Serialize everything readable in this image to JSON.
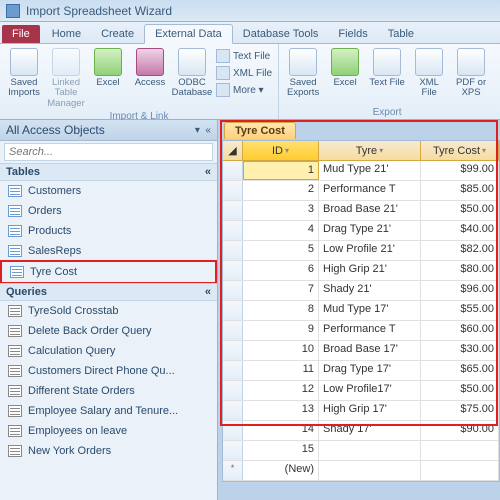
{
  "titlebar": {
    "title": "Import Spreadsheet Wizard"
  },
  "tabs": {
    "file": "File",
    "items": [
      "Home",
      "Create",
      "External Data",
      "Database Tools",
      "Fields",
      "Table"
    ],
    "active": 2
  },
  "ribbon": {
    "group1": {
      "label": "Import & Link",
      "saved_imports": "Saved Imports",
      "linked_table": "Linked Table Manager",
      "excel": "Excel",
      "access": "Access",
      "odbc": "ODBC Database",
      "text_file": "Text File",
      "xml_file": "XML File",
      "more": "More ▾"
    },
    "group2": {
      "label": "Export",
      "saved_exports": "Saved Exports",
      "excel": "Excel",
      "text_file": "Text File",
      "xml_file": "XML File",
      "pdf": "PDF or XPS"
    }
  },
  "nav": {
    "title": "All Access Objects",
    "search_placeholder": "Search...",
    "cat_tables": "Tables",
    "cat_queries": "Queries",
    "tables": [
      "Customers",
      "Orders",
      "Products",
      "SalesReps",
      "Tyre Cost"
    ],
    "queries": [
      "TyreSold Crosstab",
      "Delete Back Order Query",
      "Calculation Query",
      "Customers Direct Phone Qu...",
      "Different State Orders",
      "Employee Salary and Tenure...",
      "Employees on leave",
      "New York Orders"
    ]
  },
  "doc": {
    "tab": "Tyre Cost",
    "cols": {
      "id": "ID",
      "tyre": "Tyre",
      "cost": "Tyre Cost"
    },
    "rows": [
      {
        "id": "1",
        "tyre": "Mud Type 21'",
        "cost": "$99.00"
      },
      {
        "id": "2",
        "tyre": "Performance T",
        "cost": "$85.00"
      },
      {
        "id": "3",
        "tyre": "Broad Base 21'",
        "cost": "$50.00"
      },
      {
        "id": "4",
        "tyre": "Drag Type 21'",
        "cost": "$40.00"
      },
      {
        "id": "5",
        "tyre": "Low Profile 21'",
        "cost": "$82.00"
      },
      {
        "id": "6",
        "tyre": "High Grip 21'",
        "cost": "$80.00"
      },
      {
        "id": "7",
        "tyre": "Shady 21'",
        "cost": "$96.00"
      },
      {
        "id": "8",
        "tyre": "Mud Type 17'",
        "cost": "$55.00"
      },
      {
        "id": "9",
        "tyre": "Performance T",
        "cost": "$60.00"
      },
      {
        "id": "10",
        "tyre": "Broad Base 17'",
        "cost": "$30.00"
      },
      {
        "id": "11",
        "tyre": "Drag Type 17'",
        "cost": "$65.00"
      },
      {
        "id": "12",
        "tyre": "Low Profile17'",
        "cost": "$50.00"
      },
      {
        "id": "13",
        "tyre": "High Grip 17'",
        "cost": "$75.00"
      },
      {
        "id": "14",
        "tyre": "Shady 17'",
        "cost": "$90.00"
      },
      {
        "id": "15",
        "tyre": "",
        "cost": ""
      }
    ],
    "new_row": "(New)",
    "new_marker": "*"
  }
}
